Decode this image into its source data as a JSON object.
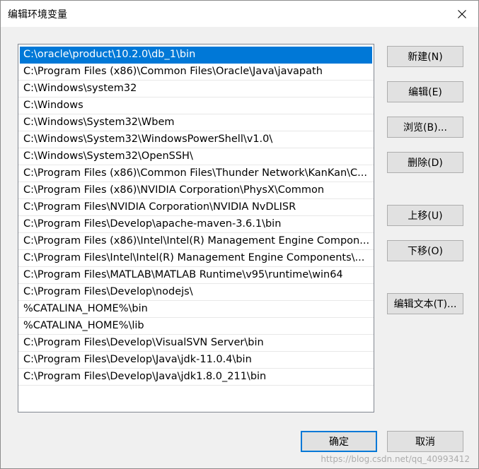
{
  "window": {
    "title": "编辑环境变量"
  },
  "paths": [
    "C:\\oracle\\product\\10.2.0\\db_1\\bin",
    "C:\\Program Files (x86)\\Common Files\\Oracle\\Java\\javapath",
    "C:\\Windows\\system32",
    "C:\\Windows",
    "C:\\Windows\\System32\\Wbem",
    "C:\\Windows\\System32\\WindowsPowerShell\\v1.0\\",
    "C:\\Windows\\System32\\OpenSSH\\",
    "C:\\Program Files (x86)\\Common Files\\Thunder Network\\KanKan\\C...",
    "C:\\Program Files (x86)\\NVIDIA Corporation\\PhysX\\Common",
    "C:\\Program Files\\NVIDIA Corporation\\NVIDIA NvDLISR",
    "C:\\Program Files\\Develop\\apache-maven-3.6.1\\bin",
    "C:\\Program Files (x86)\\Intel\\Intel(R) Management Engine Compon...",
    "C:\\Program Files\\Intel\\Intel(R) Management Engine Components\\...",
    "C:\\Program Files\\MATLAB\\MATLAB Runtime\\v95\\runtime\\win64",
    "C:\\Program Files\\Develop\\nodejs\\",
    "%CATALINA_HOME%\\bin",
    "%CATALINA_HOME%\\lib",
    "C:\\Program Files\\Develop\\VisualSVN Server\\bin",
    "C:\\Program Files\\Develop\\Java\\jdk-11.0.4\\bin",
    "C:\\Program Files\\Develop\\Java\\jdk1.8.0_211\\bin"
  ],
  "selected_index": 0,
  "buttons": {
    "new": "新建(N)",
    "edit": "编辑(E)",
    "browse": "浏览(B)...",
    "delete": "删除(D)",
    "move_up": "上移(U)",
    "move_down": "下移(O)",
    "edit_text": "编辑文本(T)...",
    "ok": "确定",
    "cancel": "取消"
  },
  "watermark": "https://blog.csdn.net/qq_40993412",
  "colors": {
    "selection": "#0078d7",
    "default_button_border": "#0078d7"
  }
}
